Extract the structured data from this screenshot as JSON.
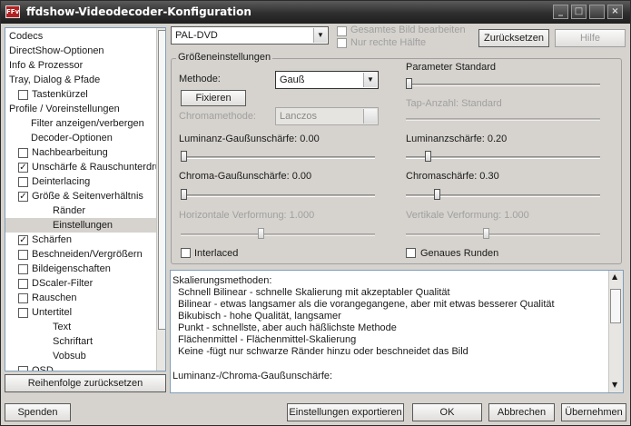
{
  "window": {
    "title": "ffdshow-Videodecoder-Konfiguration",
    "icon_text": "FFv",
    "controls": [
      "_",
      "□",
      "×"
    ]
  },
  "sidebar": {
    "items": [
      {
        "label": "Codecs",
        "indent": 0,
        "checkbox": null,
        "selected": false
      },
      {
        "label": "DirectShow-Optionen",
        "indent": 0,
        "checkbox": null,
        "selected": false
      },
      {
        "label": "Info & Prozessor",
        "indent": 0,
        "checkbox": null,
        "selected": false
      },
      {
        "label": "Tray, Dialog & Pfade",
        "indent": 0,
        "checkbox": null,
        "selected": false
      },
      {
        "label": "Tastenkürzel",
        "indent": 1,
        "checkbox": false,
        "selected": false
      },
      {
        "label": "Profile / Voreinstellungen",
        "indent": 0,
        "checkbox": null,
        "selected": false
      },
      {
        "label": "Filter anzeigen/verbergen",
        "indent": 2,
        "checkbox": null,
        "selected": false
      },
      {
        "label": "Decoder-Optionen",
        "indent": 2,
        "checkbox": null,
        "selected": false
      },
      {
        "label": "Nachbearbeitung",
        "indent": 1,
        "checkbox": false,
        "selected": false
      },
      {
        "label": "Unschärfe & Rauschunterdrü",
        "indent": 1,
        "checkbox": true,
        "selected": false
      },
      {
        "label": "Deinterlacing",
        "indent": 1,
        "checkbox": false,
        "selected": false
      },
      {
        "label": "Größe & Seitenverhältnis",
        "indent": 1,
        "checkbox": true,
        "selected": false
      },
      {
        "label": "Ränder",
        "indent": 3,
        "checkbox": null,
        "selected": false
      },
      {
        "label": "Einstellungen",
        "indent": 3,
        "checkbox": null,
        "selected": true
      },
      {
        "label": "Schärfen",
        "indent": 1,
        "checkbox": true,
        "selected": false
      },
      {
        "label": "Beschneiden/Vergrößern",
        "indent": 1,
        "checkbox": false,
        "selected": false
      },
      {
        "label": "Bildeigenschaften",
        "indent": 1,
        "checkbox": false,
        "selected": false
      },
      {
        "label": "DScaler-Filter",
        "indent": 1,
        "checkbox": false,
        "selected": false
      },
      {
        "label": "Rauschen",
        "indent": 1,
        "checkbox": false,
        "selected": false
      },
      {
        "label": "Untertitel",
        "indent": 1,
        "checkbox": false,
        "selected": false
      },
      {
        "label": "Text",
        "indent": 3,
        "checkbox": null,
        "selected": false
      },
      {
        "label": "Schriftart",
        "indent": 3,
        "checkbox": null,
        "selected": false
      },
      {
        "label": "Vobsub",
        "indent": 3,
        "checkbox": null,
        "selected": false
      },
      {
        "label": "OSD",
        "indent": 1,
        "checkbox": false,
        "selected": false
      }
    ],
    "reset_order_label": "Reihenfolge zurücksetzen"
  },
  "top": {
    "preset_value": "PAL-DVD",
    "whole_image_label": "Gesamtes Bild bearbeiten",
    "right_half_label": "Nur rechte Hälfte",
    "reset_label": "Zurücksetzen",
    "help_label": "Hilfe"
  },
  "size_group": {
    "title": "Größeneinstellungen",
    "method_label": "Methode:",
    "method_value": "Gauß",
    "fix_label": "Fixieren",
    "chroma_method_label": "Chromamethode:",
    "chroma_method_value": "Lanczos",
    "param_title": "Parameter Standard",
    "tap_label": "Tap-Anzahl: Standard",
    "luma_gauss_label": "Luminanz-Gaußunschärfe: 0.00",
    "luma_sharp_label": "Luminanzschärfe: 0.20",
    "chroma_gauss_label": "Chroma-Gaußunschärfe: 0.00",
    "chroma_sharp_label": "Chromaschärfe: 0.30",
    "h_warp_label": "Horizontale Verformung: 1.000",
    "v_warp_label": "Vertikale Verformung: 1.000",
    "interlaced_label": "Interlaced",
    "accurate_round_label": "Genaues Runden",
    "values": {
      "param": 0.0,
      "luma_gauss": 0.0,
      "luma_sharp": 0.1,
      "chroma_gauss": 0.0,
      "chroma_sharp": 0.15,
      "h_warp": 0.41,
      "v_warp": 0.41
    }
  },
  "info": {
    "heading": "Skalierungsmethoden:",
    "lines": [
      "Schnell Bilinear - schnelle Skalierung mit akzeptabler Qualität",
      "Bilinear - etwas langsamer als die vorangegangene, aber mit etwas besserer Qualität",
      "Bikubisch - hohe Qualität, langsamer",
      "Punkt - schnellste, aber auch häßlichste Methode",
      "Flächenmittel - Flächenmittel-Skalierung",
      "Keine -fügt nur schwarze Ränder hinzu oder beschneidet das Bild"
    ],
    "footer": "Luminanz-/Chroma-Gaußunschärfe:"
  },
  "bottom": {
    "donate_label": "Spenden",
    "export_label": "Einstellungen exportieren",
    "ok_label": "OK",
    "cancel_label": "Abbrechen",
    "apply_label": "Übernehmen"
  }
}
